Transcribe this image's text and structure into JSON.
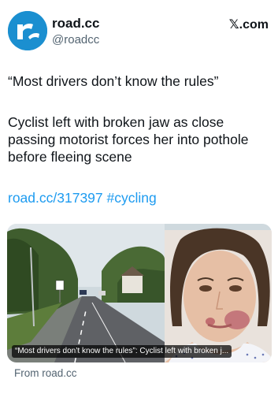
{
  "header": {
    "display_name": "road.cc",
    "handle": "@roadcc",
    "brand": "𝕏.com"
  },
  "tweet": {
    "quote_line": "“Most drivers don’t know the rules”",
    "body": "Cyclist left with broken jaw as close passing motorist forces her into pothole before fleeing scene",
    "link": "road.cc/317397",
    "hashtag": "#cycling"
  },
  "card": {
    "caption": "“Most drivers don’t know the rules”: Cyclist left with broken j...",
    "source": "From road.cc"
  },
  "colors": {
    "accent": "#1d9bf0",
    "avatar_bg": "#1b8fd0",
    "secondary_text": "#536471"
  }
}
